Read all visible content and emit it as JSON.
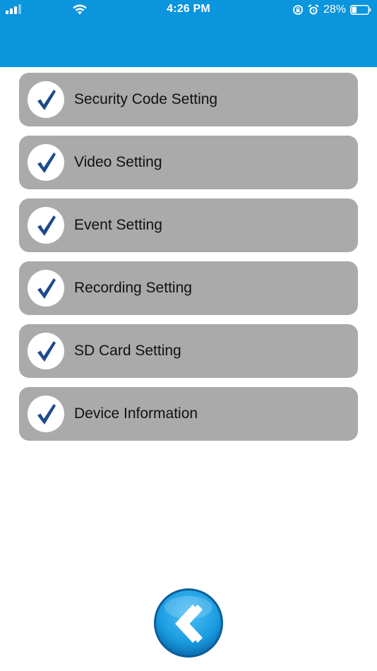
{
  "status_bar": {
    "time": "4:26 PM",
    "battery_percent": "28%",
    "icons": [
      "cellular-signal-icon",
      "wifi-icon",
      "rotation-lock-icon",
      "alarm-icon",
      "battery-icon"
    ]
  },
  "menu": {
    "items": [
      {
        "label": "Security Code Setting",
        "icon": "checkmark-icon"
      },
      {
        "label": "Video Setting",
        "icon": "checkmark-icon"
      },
      {
        "label": "Event Setting",
        "icon": "checkmark-icon"
      },
      {
        "label": "Recording Setting",
        "icon": "checkmark-icon"
      },
      {
        "label": "SD Card Setting",
        "icon": "checkmark-icon"
      },
      {
        "label": "Device Information",
        "icon": "checkmark-icon"
      }
    ]
  },
  "footer": {
    "back_icon": "chevron-left-icon"
  },
  "colors": {
    "header": "#0a95dc",
    "menu_item_bg": "#aaaaaa",
    "checkmark": "#1c4a8c",
    "back_button": "#1a9be0"
  }
}
